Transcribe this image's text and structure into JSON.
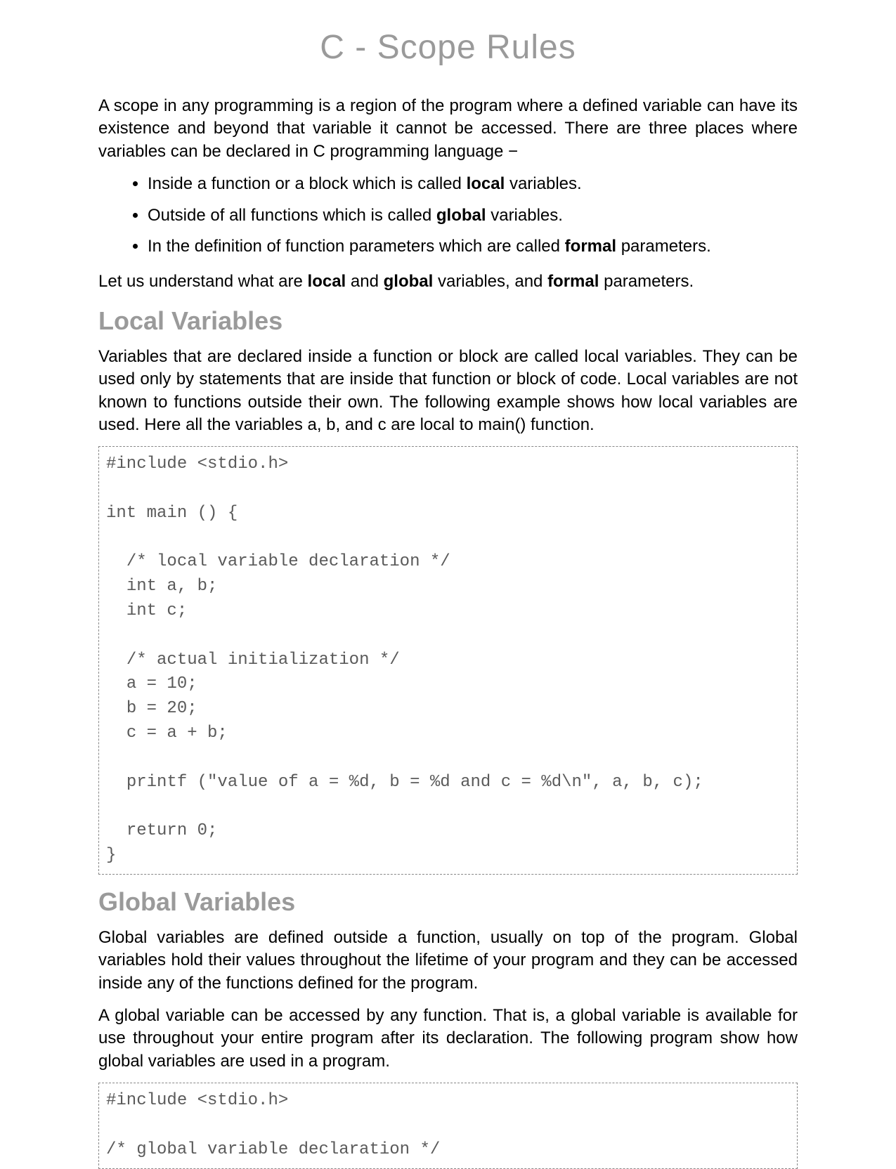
{
  "title": "C - Scope Rules",
  "intro": "A scope in any programming is a region of the program where a defined variable can have its existence and beyond that variable it cannot be accessed. There are three places where variables can be declared in C programming language −",
  "bullets": [
    {
      "pre": "Inside a function or a block which is called ",
      "bold": "local",
      "post": " variables."
    },
    {
      "pre": "Outside of all functions which is called ",
      "bold": "global",
      "post": " variables."
    },
    {
      "pre": "In the definition of function parameters which are called ",
      "bold": "formal",
      "post": " parameters."
    }
  ],
  "understand": {
    "pre": "Let us understand what are ",
    "b1": "local",
    "mid1": " and ",
    "b2": "global",
    "mid2": " variables, and ",
    "b3": "formal",
    "post": " parameters."
  },
  "local": {
    "heading": "Local Variables",
    "para": "Variables that are declared inside a function or block are called local variables. They can be used only by statements that are inside that function or block of code. Local variables are not known to functions outside their own. The following example shows how local variables are used. Here all the variables a, b, and c are local to main() function.",
    "code": "#include <stdio.h>\n\nint main () {\n\n  /* local variable declaration */\n  int a, b;\n  int c;\n\n  /* actual initialization */\n  a = 10;\n  b = 20;\n  c = a + b;\n\n  printf (\"value of a = %d, b = %d and c = %d\\n\", a, b, c);\n\n  return 0;\n}"
  },
  "global": {
    "heading": "Global Variables",
    "para1": "Global variables are defined outside a function, usually on top of the program. Global variables hold their values throughout the lifetime of your program and they can be accessed inside any of the functions defined for the program.",
    "para2": "A global variable can be accessed by any function. That is, a global variable is available for use throughout your entire program after its declaration. The following program show how global variables are used in a program.",
    "code": "#include <stdio.h>\n\n/* global variable declaration */"
  }
}
